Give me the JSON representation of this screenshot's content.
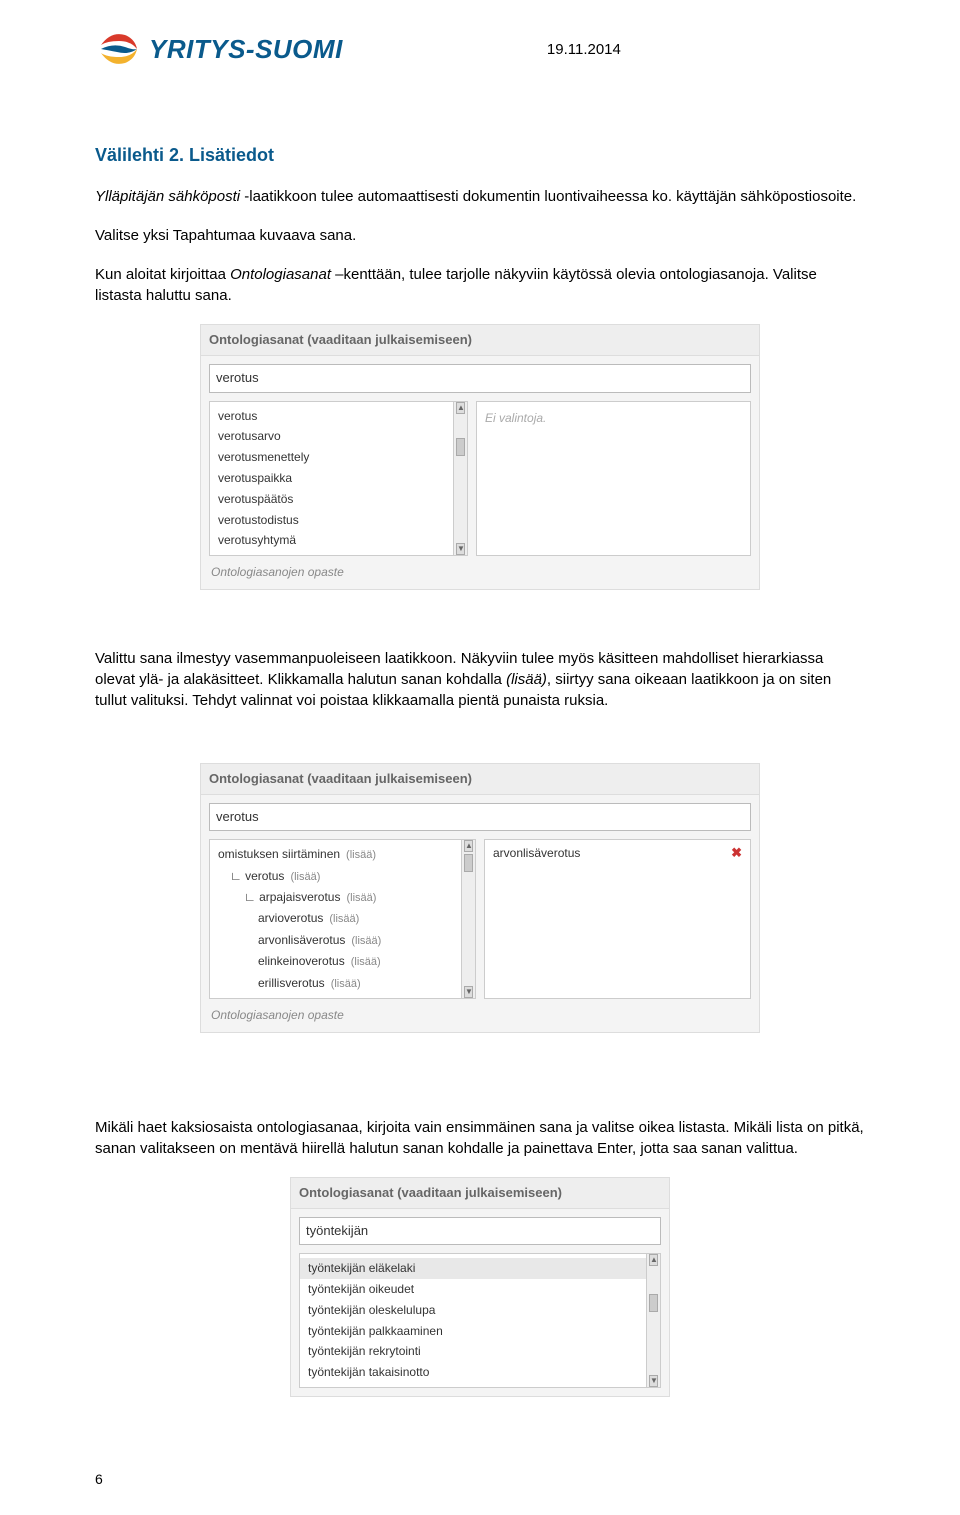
{
  "header": {
    "logo_text": "YRITYS-SUOMI",
    "date": "19.11.2014"
  },
  "section": {
    "title": "Välilehti 2. Lisätiedot",
    "para1_a": "Ylläpitäjän sähköposti ",
    "para1_b": "-laatikkoon tulee automaattisesti dokumentin luontivaiheessa ko. käyttäjän sähköpostiosoite.",
    "para2_a": "Valitse yksi Tapahtumaa kuvaava sana.",
    "para3_a": "Kun aloitat kirjoittaa ",
    "para3_b": "Ontologiasanat ",
    "para3_c": "–kenttään, tulee tarjolle näkyviin käytössä olevia ontologiasanoja. Valitse listasta haluttu sana.",
    "para4": "Valittu sana ilmestyy vasemmanpuoleiseen laatikkoon. Näkyviin tulee myös käsitteen mahdolliset hierarkiassa olevat ylä- ja alakäsitteet. Klikkamalla halutun sanan kohdalla ",
    "para4_i": "(lisää)",
    "para4_b": ", siirtyy sana oikeaan laatikkoon ja on siten tullut valituksi. Tehdyt valinnat voi poistaa klikkaamalla pientä punaista ruksia.",
    "para5": "Mikäli haet kaksiosaista ontologiasanaa, kirjoita vain ensimmäinen sana ja valitse oikea listasta. Mikäli lista on pitkä, sanan valitakseen on mentävä hiirellä halutun sanan kohdalle ja painettava Enter, jotta saa sanan valittua."
  },
  "panel1": {
    "title": "Ontologiasanat (vaaditaan julkaisemiseen)",
    "input": "verotus",
    "options": [
      "verotus",
      "verotusarvo",
      "verotusmenettely",
      "verotuspaikka",
      "verotuspäätös",
      "verotustodistus",
      "verotusyhtymä"
    ],
    "right_placeholder": "Ei valintoja.",
    "foot": "Ontologiasanojen opaste"
  },
  "panel2": {
    "title": "Ontologiasanat (vaaditaan julkaisemiseen)",
    "input": "verotus",
    "tree": [
      {
        "label": "omistuksen siirtäminen",
        "suffix": "(lisää)",
        "indent": 0
      },
      {
        "label": "∟ verotus",
        "suffix": "(lisää)",
        "indent": 1
      },
      {
        "label": "∟ arpajaisverotus",
        "suffix": "(lisää)",
        "indent": 2
      },
      {
        "label": "arvioverotus",
        "suffix": "(lisää)",
        "indent": 3
      },
      {
        "label": "arvonlisäverotus",
        "suffix": "(lisää)",
        "indent": 3
      },
      {
        "label": "elinkeinoverotus",
        "suffix": "(lisää)",
        "indent": 3
      },
      {
        "label": "erillisverotus",
        "suffix": "(lisää)",
        "indent": 3
      }
    ],
    "selected": "arvonlisäverotus",
    "foot": "Ontologiasanojen opaste"
  },
  "panel3": {
    "title": "Ontologiasanat (vaaditaan julkaisemiseen)",
    "input": "työntekijän",
    "options": [
      "työntekijän eläkelaki",
      "työntekijän oikeudet",
      "työntekijän oleskelulupa",
      "työntekijän palkkaaminen",
      "työntekijän rekrytointi",
      "työntekijän takaisinotto"
    ]
  },
  "page_num": "6"
}
